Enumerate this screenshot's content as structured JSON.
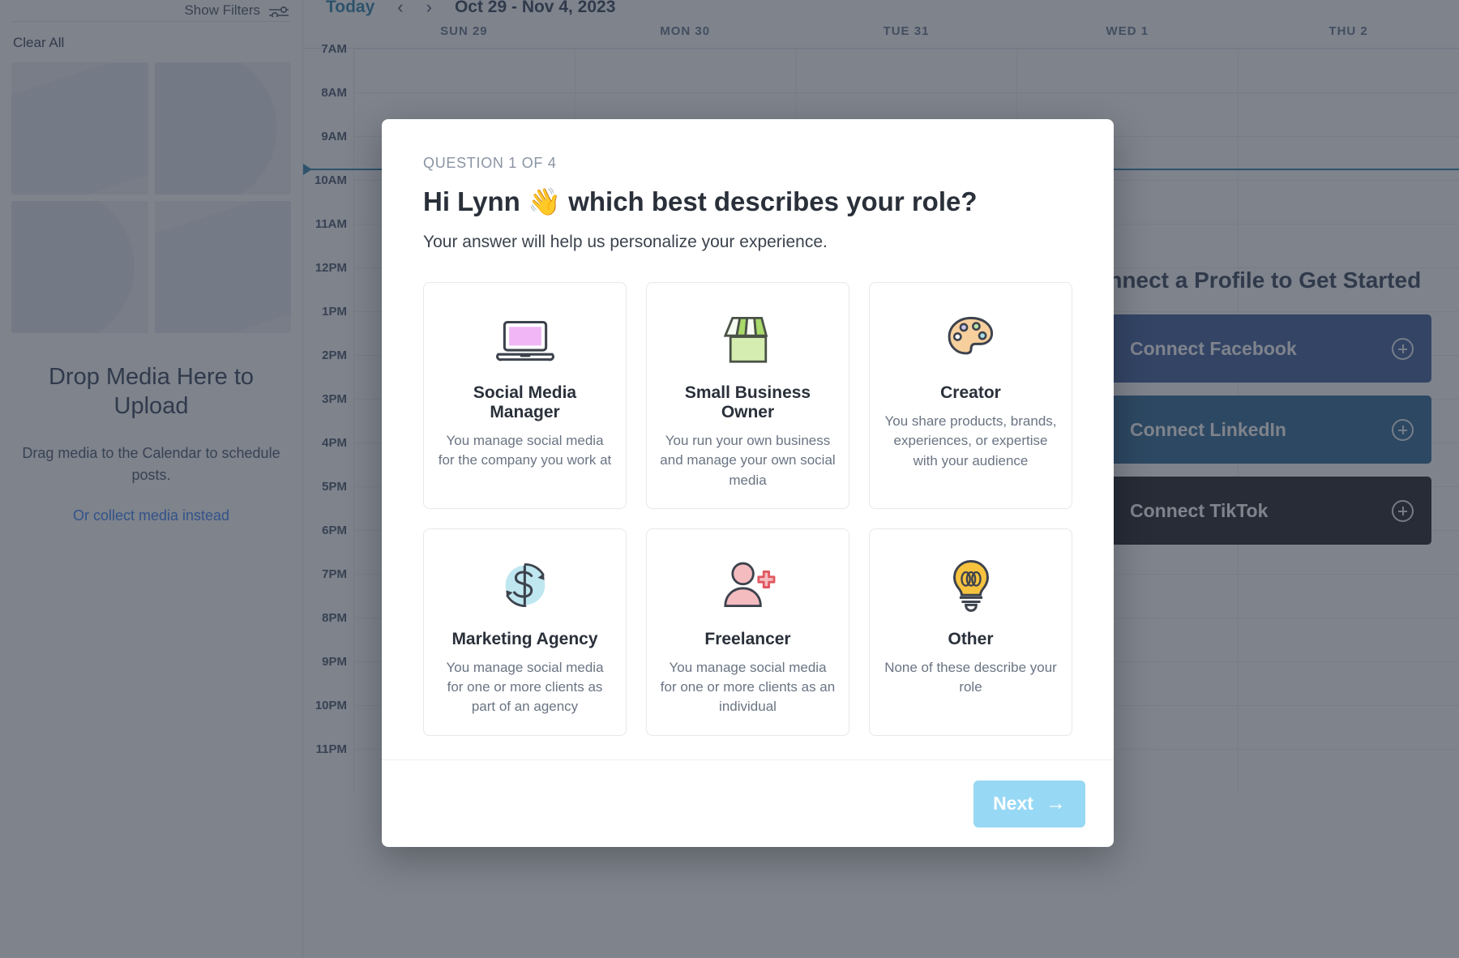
{
  "background": {
    "media_panel": {
      "show_filters_label": "Show Filters",
      "filters_icon": "sliders-icon",
      "clear_all_label": "Clear All",
      "empty_title": "Drop Media Here to Upload",
      "empty_sub": "Drag media to the Calendar to schedule posts.",
      "empty_link": "Or collect media instead"
    },
    "calendar": {
      "today_label": "Today",
      "prev_icon": "chevron-left-icon",
      "next_icon": "chevron-right-icon",
      "date_range": "Oct 29 - Nov 4, 2023",
      "day_headers": [
        "",
        "SUN 29",
        "MON 30",
        "TUE 31",
        "WED 1",
        "THU 2"
      ],
      "time_labels": [
        "7AM",
        "8AM",
        "9AM",
        "10AM",
        "11AM",
        "12PM",
        "1PM",
        "2PM",
        "3PM",
        "4PM",
        "5PM",
        "6PM",
        "7PM",
        "8PM",
        "9PM",
        "10PM",
        "11PM"
      ]
    },
    "get_started": {
      "title": "Connect a Profile to Get Started",
      "buttons": [
        {
          "brand": "f",
          "label": "Connect Facebook",
          "color": "#3b5998",
          "icon": "facebook-icon"
        },
        {
          "brand": "in",
          "label": "Connect LinkedIn",
          "color": "#2a6591",
          "icon": "linkedin-icon"
        },
        {
          "brand": "♪",
          "label": "Connect TikTok",
          "color": "#1b1b20",
          "icon": "tiktok-icon"
        }
      ],
      "add_icon": "plus-circle-icon"
    }
  },
  "modal": {
    "question_counter": "QUESTION 1 OF 4",
    "title": "Hi Lynn 👋 which best describes your role?",
    "subtitle": "Your answer will help us personalize your experience.",
    "options": [
      {
        "icon": "laptop-icon",
        "title": "Social Media Manager",
        "description": "You manage social media for the company you work at"
      },
      {
        "icon": "storefront-icon",
        "title": "Small Business Owner",
        "description": "You run your own business and manage your own social media"
      },
      {
        "icon": "paint-palette-icon",
        "title": "Creator",
        "description": "You share products, brands, experiences, or expertise with your audience"
      },
      {
        "icon": "dollar-refresh-icon",
        "title": "Marketing Agency",
        "description": "You manage social media for one or more clients as part of an agency"
      },
      {
        "icon": "person-plus-icon",
        "title": "Freelancer",
        "description": "You manage social media for one or more clients as an individual"
      },
      {
        "icon": "lightbulb-icon",
        "title": "Other",
        "description": "None of these describe your role"
      }
    ],
    "next_label": "Next",
    "next_arrow": "→",
    "next_color": "#97d8f4"
  }
}
